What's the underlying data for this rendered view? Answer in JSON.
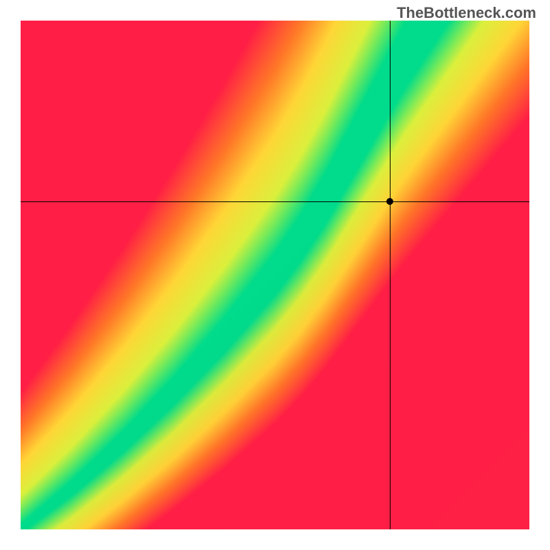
{
  "watermark": "TheBottleneck.com",
  "chart_data": {
    "type": "heatmap",
    "title": "",
    "xlabel": "",
    "ylabel": "",
    "xlim": [
      0,
      1
    ],
    "ylim": [
      0,
      1
    ],
    "crosshair": {
      "x": 0.725,
      "y": 0.645
    },
    "marker": {
      "x": 0.725,
      "y": 0.645
    },
    "optimal_ridge": {
      "description": "Green diagonal band running from bottom-left to top-right, curved with steeper slope in upper half",
      "points_x": [
        0.0,
        0.1,
        0.2,
        0.3,
        0.4,
        0.5,
        0.55,
        0.6,
        0.65,
        0.7,
        0.75,
        0.8
      ],
      "points_y": [
        0.0,
        0.08,
        0.17,
        0.27,
        0.38,
        0.5,
        0.57,
        0.65,
        0.74,
        0.83,
        0.92,
        1.0
      ]
    },
    "gradient_corners": {
      "top_left": "red",
      "top_right": "yellow",
      "bottom_left": "red",
      "bottom_right": "red",
      "ridge": "green"
    }
  }
}
